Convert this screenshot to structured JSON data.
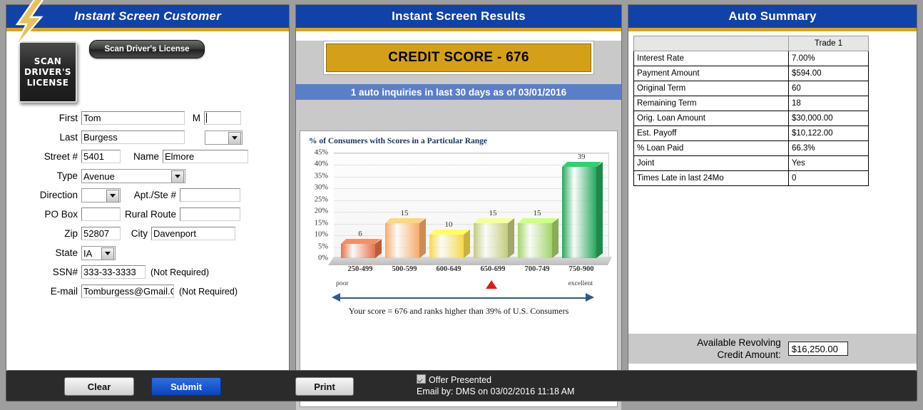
{
  "left": {
    "title": "Instant Screen Customer",
    "scan_badge": [
      "SCAN",
      "DRIVER'S",
      "LICENSE"
    ],
    "scan_button": "Scan Driver's License",
    "fields": {
      "first_label": "First",
      "first_value": "Tom",
      "middle_label": "M",
      "middle_value": "",
      "last_label": "Last",
      "last_value": "Burgess",
      "suffix_value": "",
      "street_num_label": "Street #",
      "street_num_value": "5401",
      "street_name_label": "Name",
      "street_name_value": "Elmore",
      "type_label": "Type",
      "type_value": "Avenue",
      "direction_label": "Direction",
      "direction_value": "",
      "apt_label": "Apt./Ste #",
      "apt_value": "",
      "pobox_label": "PO Box",
      "pobox_value": "",
      "rural_label": "Rural Route",
      "rural_value": "",
      "zip_label": "Zip",
      "zip_value": "52807",
      "city_label": "City",
      "city_value": "Davenport",
      "state_label": "State",
      "state_value": "IA",
      "ssn_label": "SSN#",
      "ssn_value": "333-33-3333",
      "ssn_note": "(Not Required)",
      "email_label": "E-mail",
      "email_value": "Tomburgess@Gmail.C",
      "email_note": "(Not Required)"
    }
  },
  "middle": {
    "title": "Instant Screen Results",
    "credit_score": "CREDIT SCORE - 676",
    "inquiry_bar": "1 auto inquiries in last 30 days as of 03/01/2016",
    "scale": {
      "poor": "poor",
      "excellent": "excellent",
      "summary": "Your score = 676 and ranks higher than 39% of U.S. Consumers"
    }
  },
  "chart_data": {
    "type": "bar",
    "title": "% of Consumers with Scores in a Particular Range",
    "categories": [
      "250-499",
      "500-599",
      "600-649",
      "650-699",
      "700-749",
      "750-900"
    ],
    "values": [
      6,
      15,
      10,
      15,
      15,
      39
    ],
    "colors": [
      "#e2714a",
      "#f7ab68",
      "#f6d94a",
      "#c3cc7e",
      "#a4d468",
      "#25a85a"
    ],
    "xlabel": "",
    "ylabel": "",
    "ylim": [
      0,
      45
    ],
    "yticks": [
      "0%",
      "5%",
      "10%",
      "15%",
      "20%",
      "25%",
      "30%",
      "35%",
      "40%",
      "45%"
    ],
    "grid": true,
    "legend": false
  },
  "right": {
    "title": "Auto Summary",
    "table": {
      "headers": [
        "",
        "Trade 1"
      ],
      "rows": [
        {
          "k": "Interest Rate",
          "v": "7.00%"
        },
        {
          "k": "Payment Amount",
          "v": "$594.00"
        },
        {
          "k": "Original Term",
          "v": "60"
        },
        {
          "k": "Remaining Term",
          "v": "18"
        },
        {
          "k": "Orig. Loan Amount",
          "v": "$30,000.00"
        },
        {
          "k": "Est. Payoff",
          "v": "$10,122.00"
        },
        {
          "k": "% Loan Paid",
          "v": "66.3%"
        },
        {
          "k": "Joint",
          "v": "Yes"
        },
        {
          "k": "Times Late in last 24Mo",
          "v": "0"
        }
      ]
    },
    "revolving_label_1": "Available Revolving",
    "revolving_label_2": "Credit Amount:",
    "revolving_value": "$16,250.00"
  },
  "footer": {
    "clear": "Clear",
    "submit": "Submit",
    "print": "Print",
    "offer_presented": "Offer Presented",
    "email_by": "Email by: DMS  on 03/02/2016 11:18 AM"
  }
}
